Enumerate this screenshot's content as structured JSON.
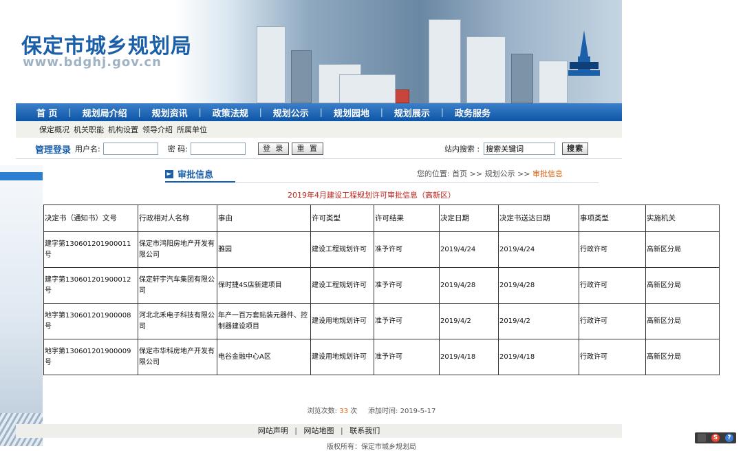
{
  "site": {
    "title": "保定市城乡规划局",
    "url": "www.bdghj.gov.cn"
  },
  "nav": {
    "items": [
      "首  页",
      "规划局介绍",
      "规划资讯",
      "政策法规",
      "规划公示",
      "规划园地",
      "规划展示",
      "政务服务"
    ],
    "separator": "|"
  },
  "subnav": {
    "items": [
      "保定概况",
      "机关职能",
      "机构设置",
      "领导介绍",
      "所属单位"
    ]
  },
  "login": {
    "title": "管理登录",
    "username_label": "用户名:",
    "password_label": "密 码:",
    "login_button": "登 录",
    "reset_button": "重 置",
    "search_label": "站内搜索 :",
    "search_value": "搜索关键词",
    "search_button": "搜索"
  },
  "section": {
    "title": "审批信息",
    "breadcrumb_prefix": "您的位置: 首页 >> 规划公示 >> ",
    "breadcrumb_current": "审批信息"
  },
  "document": {
    "title": "2019年4月建设工程规划许可审批信息（高新区）"
  },
  "table": {
    "headers": [
      "决定书（通知书）文号",
      "行政相对人名称",
      "事由",
      "许可类型",
      "许可结果",
      "决定日期",
      "决定书送达日期",
      "事项类型",
      "实施机关"
    ],
    "rows": [
      [
        "建字第130601201900011号",
        "保定市鸿阳房地产开发有限公司",
        "雅园",
        "建设工程规划许可",
        "准予许可",
        "2019/4/24",
        "2019/4/24",
        "行政许可",
        "高新区分局"
      ],
      [
        "建字第130601201900012号",
        "保定轩宇汽车集团有限公司",
        "保时捷4S店新建项目",
        "建设工程规划许可",
        "准予许可",
        "2019/4/28",
        "2019/4/28",
        "行政许可",
        "高新区分局"
      ],
      [
        "地字第130601201900008号",
        "河北北禾电子科技有限公司",
        "年产一百万套贴装元器件、控制器建设项目",
        "建设用地规划许可",
        "准予许可",
        "2019/4/2",
        "2019/4/2",
        "行政许可",
        "高新区分局"
      ],
      [
        "地字第130601201900009号",
        "保定市华科房地产开发有限公司",
        "电谷金融中心A区",
        "建设用地规划许可",
        "准予许可",
        "2019/4/18",
        "2019/4/18",
        "行政许可",
        "高新区分局"
      ]
    ]
  },
  "stats": {
    "views_label": "浏览次数:",
    "views_count": "33",
    "views_unit": "次",
    "added_label": "添加时间:",
    "added_date": "2019-5-17"
  },
  "footer": {
    "links": [
      "网站声明",
      "网站地图",
      "联系我们"
    ],
    "copyright_partial": "版权所有：保定市城乡规划局"
  },
  "colors": {
    "brand_blue": "#1b5fa8",
    "nav_blue": "#0e56a6",
    "accent_red": "#c0231b",
    "accent_orange": "#d9600a"
  }
}
